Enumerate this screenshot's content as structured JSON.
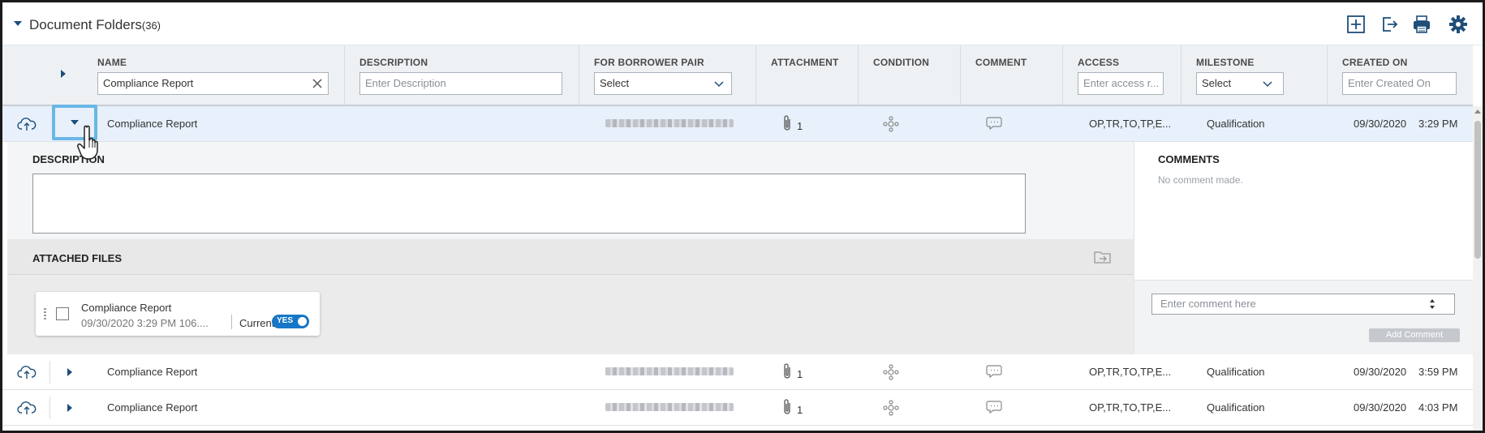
{
  "header": {
    "title": "Document Folders",
    "count": "(36)"
  },
  "columns": {
    "name": {
      "label": "NAME",
      "value": "Compliance Report"
    },
    "description": {
      "label": "DESCRIPTION",
      "placeholder": "Enter Description"
    },
    "borrower_pair": {
      "label": "FOR BORROWER PAIR",
      "value": "Select"
    },
    "attachment": {
      "label": "ATTACHMENT"
    },
    "condition": {
      "label": "CONDITION"
    },
    "comment": {
      "label": "COMMENT"
    },
    "access": {
      "label": "ACCESS",
      "placeholder": "Enter access r..."
    },
    "milestone": {
      "label": "MILESTONE",
      "value": "Select"
    },
    "created_on": {
      "label": "CREATED ON",
      "placeholder": "Enter Created On"
    }
  },
  "rows": [
    {
      "name": "Compliance Report",
      "attachments": "1",
      "access": "OP,TR,TO,TP,E...",
      "milestone": "Qualification",
      "date": "09/30/2020",
      "time": "3:29 PM"
    },
    {
      "name": "Compliance Report",
      "attachments": "1",
      "access": "OP,TR,TO,TP,E...",
      "milestone": "Qualification",
      "date": "09/30/2020",
      "time": "3:59 PM"
    },
    {
      "name": "Compliance Report",
      "attachments": "1",
      "access": "OP,TR,TO,TP,E...",
      "milestone": "Qualification",
      "date": "09/30/2020",
      "time": "4:03 PM"
    }
  ],
  "expanded": {
    "description_label": "DESCRIPTION",
    "attached_files_label": "ATTACHED FILES",
    "file": {
      "name": "Compliance Report",
      "meta": "09/30/2020   3:29 PM   106....",
      "current_label": "Current",
      "toggle_label": "YES",
      "current": true
    },
    "comments_label": "COMMENTS",
    "no_comment": "No comment made.",
    "comment_placeholder": "Enter comment here",
    "add_comment": "Add Comment"
  },
  "colors": {
    "accent": "#1f4e79",
    "highlight": "#6ab7e6",
    "toggle": "#1677c8",
    "selected_row": "#e8f1fb"
  }
}
